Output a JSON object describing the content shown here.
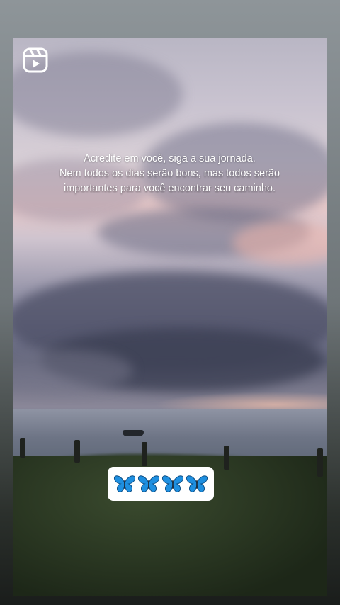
{
  "story": {
    "caption_lines": [
      "Acredite em você, siga a sua jornada.",
      "Nem todos os dias serão bons, mas todos serão",
      "importantes para você encontrar seu caminho."
    ],
    "sticker_text": "🦋🦋🦋🦋",
    "icons": {
      "reels": "reels-icon",
      "butterfly": "butterfly-icon"
    },
    "colors": {
      "butterfly_blue": "#1e8fe0",
      "caption_text": "#ffffff",
      "sticker_bg": "#ffffff"
    }
  }
}
